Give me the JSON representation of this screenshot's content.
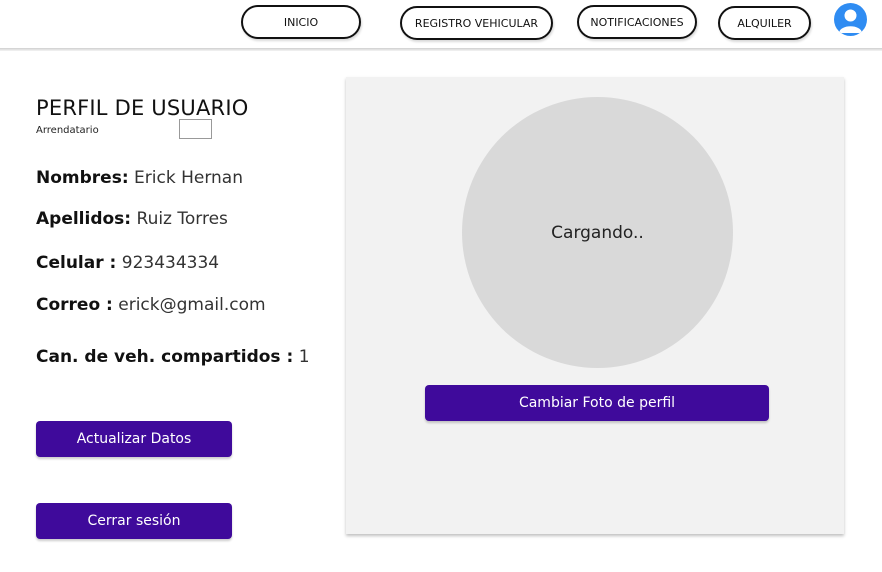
{
  "nav": {
    "inicio": "INICIO",
    "registro": "REGISTRO VEHICULAR",
    "notificaciones": "NOTIFICACIONES",
    "alquiler": "ALQUILER",
    "avatar_icon": "user-avatar-icon"
  },
  "profile": {
    "title": "PERFIL DE USUARIO",
    "role": "Arrendatario",
    "fields": [
      {
        "label": "Nombres:",
        "value": "Erick Hernan"
      },
      {
        "label": "Apellidos:",
        "value": "Ruiz Torres"
      },
      {
        "label": "Celular :",
        "value": "923434334"
      },
      {
        "label": "Correo :",
        "value": "erick@gmail.com"
      },
      {
        "label": "Can. de veh. compartidos :",
        "value": "1"
      }
    ],
    "update_button": "Actualizar Datos",
    "logout_button": "Cerrar sesión"
  },
  "photo": {
    "status": "Cargando..",
    "change_button": "Cambiar Foto de perfil"
  },
  "colors": {
    "primary": "#3f0a9b",
    "avatar": "#2f8cf2",
    "panel": "#f2f2f2",
    "circle": "#d9d9d9"
  }
}
